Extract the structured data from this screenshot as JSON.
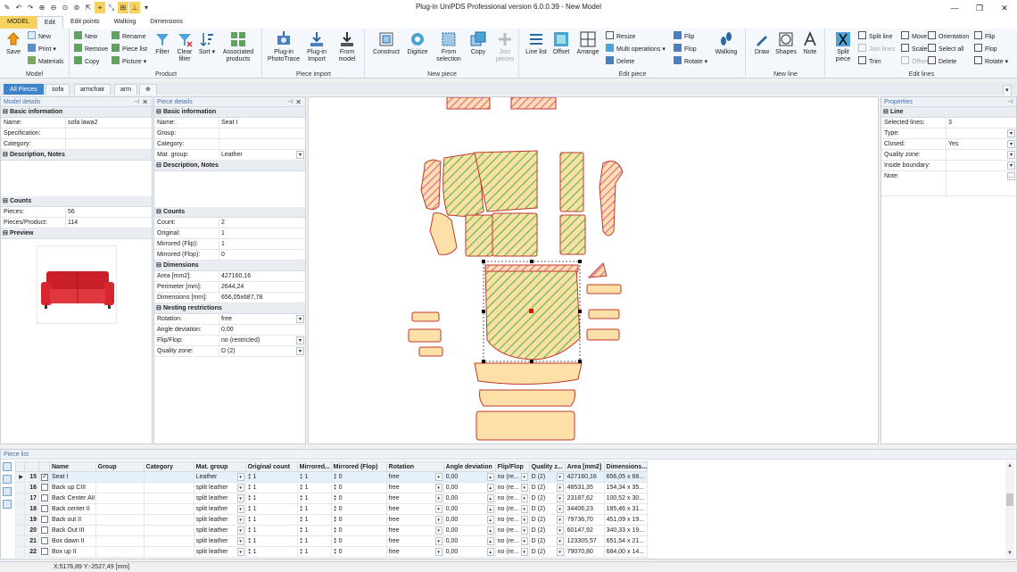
{
  "title_bar": {
    "title": "Plug-in UniPDS Professional version 6.0.0.39 - New Model",
    "window_buttons": [
      "minimize-icon",
      "restore-icon",
      "close-icon"
    ]
  },
  "menu_tabs": [
    {
      "label": "MODEL"
    },
    {
      "label": "Edit"
    },
    {
      "label": "Edit points"
    },
    {
      "label": "Walking"
    },
    {
      "label": "Dimensions"
    }
  ],
  "ribbon": {
    "model": {
      "label": "Model",
      "save": "Save",
      "new": "New",
      "print": "Print",
      "materials": "Materials"
    },
    "product": {
      "label": "Product",
      "new": "New",
      "remove": "Remove",
      "copy": "Copy",
      "rename": "Rename",
      "piece_list": "Piece list",
      "picture": "Picture",
      "filter": "Filter",
      "clear_filter": "Clear filter",
      "sort": "Sort",
      "associated_products": "Associated products"
    },
    "piece_import": {
      "label": "Piece import",
      "photo_trace": "Plug-in PhotoTrace",
      "plugin_import": "Plug-in Import",
      "from_model": "From model"
    },
    "new_piece": {
      "label": "New piece",
      "construct": "Construct",
      "digitize": "Digitize",
      "from_selection": "From selection",
      "copy": "Copy",
      "join_pieces": "Join pieces"
    },
    "edit_piece": {
      "label": "Edit piece",
      "line_list": "Line list",
      "offset": "Offset",
      "arrange": "Arrange",
      "resize": "Resize",
      "multi_operations": "Multi operations",
      "delete": "Delete",
      "flip": "Flip",
      "flop": "Flop",
      "rotate": "Rotate",
      "walking": "Walking"
    },
    "new_line": {
      "label": "New line",
      "draw": "Draw",
      "shapes": "Shapes",
      "note": "Note"
    },
    "edit_lines": {
      "label": "Edit lines",
      "split_piece": "Split piece",
      "split_line": "Split line",
      "join_lines": "Join lines",
      "trim": "Trim",
      "move": "Move",
      "scale": "Scale",
      "offset": "Offset",
      "orientation": "Orientation",
      "select_all": "Select all",
      "delete": "Delete",
      "flip": "Flip",
      "flop": "Flop",
      "rotate": "Rotate"
    }
  },
  "doc_tabs": [
    "All Pieces",
    "sofa",
    "armchair",
    "arm"
  ],
  "model_details": {
    "header": "Model details",
    "basic_info": "Basic information",
    "rows": [
      {
        "key": "Name:",
        "value": "sofa lawa2"
      },
      {
        "key": "Specification:",
        "value": ""
      },
      {
        "key": "Category:",
        "value": ""
      }
    ],
    "desc_notes": "Description, Notes",
    "counts": "Counts",
    "count_rows": [
      {
        "key": "Pieces:",
        "value": "56"
      },
      {
        "key": "Pieces/Product:",
        "value": "114"
      }
    ],
    "preview": "Preview"
  },
  "piece_details": {
    "header": "Piece details",
    "basic_info": "Basic information",
    "rows": [
      {
        "key": "Name:",
        "value": "Seat I"
      },
      {
        "key": "Group:",
        "value": ""
      },
      {
        "key": "Category:",
        "value": ""
      },
      {
        "key": "Mat. group:",
        "value": "Leather"
      }
    ],
    "desc_notes": "Description, Notes",
    "counts": "Counts",
    "count_rows": [
      {
        "key": "Count:",
        "value": "2"
      },
      {
        "key": "Original:",
        "value": "1"
      },
      {
        "key": "Mirrored (Flip):",
        "value": "1"
      },
      {
        "key": "Mirrored (Flop):",
        "value": "0"
      }
    ],
    "dimensions": "Dimensions",
    "dim_rows": [
      {
        "key": "Area [mm2]:",
        "value": "427160,16"
      },
      {
        "key": "Perimeter [mm]:",
        "value": "2644,24"
      },
      {
        "key": "Dimensions [mm]:",
        "value": "656,05x687,78"
      }
    ],
    "nesting": "Nesting restrictions",
    "nest_rows": [
      {
        "key": "Rotation:",
        "value": "free"
      },
      {
        "key": "Angle deviation:",
        "value": "0,00"
      },
      {
        "key": "Flip/Flop:",
        "value": "no (restricted)"
      },
      {
        "key": "Quality zone:",
        "value": "D (2)"
      }
    ]
  },
  "properties": {
    "header": "Properties",
    "section": "Line",
    "rows": [
      {
        "key": "Selected lines:",
        "value": "3"
      },
      {
        "key": "Type:",
        "value": ""
      },
      {
        "key": "Closed:",
        "value": "Yes"
      },
      {
        "key": "Quality zone:",
        "value": ""
      },
      {
        "key": "Inside boundary:",
        "value": ""
      },
      {
        "key": "Note:",
        "value": ""
      }
    ]
  },
  "piece_list": {
    "header": "Piece list",
    "columns": [
      "Name",
      "Group",
      "Category",
      "Mat. group",
      "Original count",
      "Mirrored...",
      "Mirrored (Flop)",
      "Rotation",
      "Angle deviation",
      "Flip/Flop",
      "Quality z...",
      "Area [mm2]",
      "Dimensions..."
    ],
    "rows": [
      {
        "num": "15",
        "checked": true,
        "name": "Seat I",
        "group": "",
        "category": "",
        "mat": "Leather",
        "orig": "1",
        "mir": "1",
        "flop": "0",
        "rot": "free",
        "angle": "0,00",
        "flipflop": "no (re...",
        "quality": "D (2)",
        "area": "427160,16",
        "dims": "656,05 x 68..."
      },
      {
        "num": "16",
        "checked": false,
        "name": "Back up CIII",
        "group": "",
        "category": "",
        "mat": "split leather",
        "orig": "1",
        "mir": "1",
        "flop": "0",
        "rot": "free",
        "angle": "0,00",
        "flipflop": "no (re...",
        "quality": "D (2)",
        "area": "48531,35",
        "dims": "154,34 x 35..."
      },
      {
        "num": "17",
        "checked": false,
        "name": "Back Center AII",
        "group": "",
        "category": "",
        "mat": "split leather",
        "orig": "1",
        "mir": "1",
        "flop": "0",
        "rot": "free",
        "angle": "0,00",
        "flipflop": "no (re...",
        "quality": "D (2)",
        "area": "23187,62",
        "dims": "100,52 x 30..."
      },
      {
        "num": "18",
        "checked": false,
        "name": "Back center II",
        "group": "",
        "category": "",
        "mat": "split leather",
        "orig": "1",
        "mir": "1",
        "flop": "0",
        "rot": "free",
        "angle": "0,00",
        "flipflop": "no (re...",
        "quality": "D (2)",
        "area": "34406,23",
        "dims": "185,46 x 31..."
      },
      {
        "num": "19",
        "checked": false,
        "name": "Back out II",
        "group": "",
        "category": "",
        "mat": "split leather",
        "orig": "1",
        "mir": "1",
        "flop": "0",
        "rot": "free",
        "angle": "0,00",
        "flipflop": "no (re...",
        "quality": "D (2)",
        "area": "79736,70",
        "dims": "451,09 x 19..."
      },
      {
        "num": "20",
        "checked": false,
        "name": "Back Out III",
        "group": "",
        "category": "",
        "mat": "split leather",
        "orig": "1",
        "mir": "1",
        "flop": "0",
        "rot": "free",
        "angle": "0,00",
        "flipflop": "no (re...",
        "quality": "D (2)",
        "area": "60147,92",
        "dims": "340,33 x 19..."
      },
      {
        "num": "21",
        "checked": false,
        "name": "Box dawn II",
        "group": "",
        "category": "",
        "mat": "split leather",
        "orig": "1",
        "mir": "1",
        "flop": "0",
        "rot": "free",
        "angle": "0,00",
        "flipflop": "no (re...",
        "quality": "D (2)",
        "area": "123305,57",
        "dims": "651,54 x 21..."
      },
      {
        "num": "22",
        "checked": false,
        "name": "Box up II",
        "group": "",
        "category": "",
        "mat": "split leather",
        "orig": "1",
        "mir": "1",
        "flop": "0",
        "rot": "free",
        "angle": "0,00",
        "flipflop": "no (re...",
        "quality": "D (2)",
        "area": "79070,80",
        "dims": "684,00 x 14..."
      }
    ]
  },
  "status": {
    "coords": "X:5176,89  Y:-2527,49 [mm]"
  },
  "colors": {
    "piece_fill": "#fce0a8",
    "hatch_green": "#7cc35a",
    "hatch_pink": "#e06bb5",
    "outline": "#c0392b",
    "selection": "#ff0000",
    "sofa_red": "#d8262f"
  }
}
